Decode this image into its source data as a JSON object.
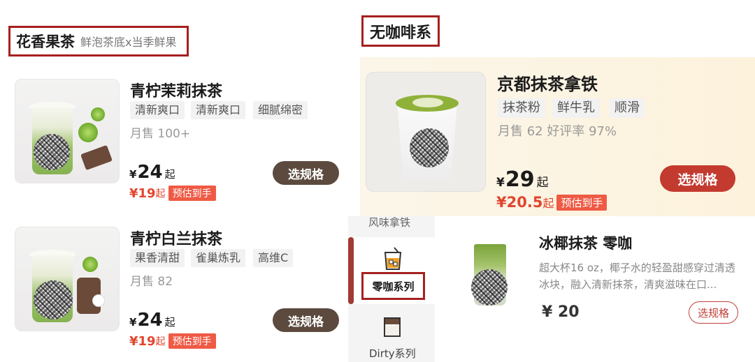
{
  "left_section": {
    "title": "花香果茶",
    "subtitle": "鲜泡茶底x当季鲜果"
  },
  "products": [
    {
      "name": "青柠茉莉抹茶",
      "tags": [
        "清新爽口",
        "清新爽口",
        "细腻绵密"
      ],
      "sales": "月售 100+",
      "price_symbol": "¥",
      "price": "24",
      "price_suffix": "起",
      "est_price": "¥19",
      "est_suffix": "起",
      "est_badge": "预估到手",
      "button": "选规格"
    },
    {
      "name": "青柠白兰抹茶",
      "tags": [
        "果香清甜",
        "雀巢炼乳",
        "高维C"
      ],
      "sales": "月售 82",
      "price_symbol": "¥",
      "price": "24",
      "price_suffix": "起",
      "est_price": "¥19",
      "est_suffix": "起",
      "est_badge": "预估到手",
      "button": "选规格"
    }
  ],
  "right_section": {
    "title": "无咖啡系"
  },
  "featured": {
    "name": "京都抹茶拿铁",
    "tags": [
      "抹茶粉",
      "鲜牛乳",
      "顺滑"
    ],
    "stats": "月售 62 好评率 97%",
    "price_symbol": "¥",
    "price": "29",
    "price_suffix": "起",
    "est_price": "¥20.5",
    "est_suffix": "起",
    "est_badge": "预估到手",
    "button": "选规格"
  },
  "sidebar": {
    "items": [
      {
        "label": "风味拿铁",
        "icon": "latte-cup-icon"
      },
      {
        "label": "零咖系列",
        "icon": "iced-drink-icon",
        "active": true
      },
      {
        "label": "Dirty系列",
        "icon": "dirty-cup-icon"
      }
    ]
  },
  "coconut": {
    "name": "冰椰抹茶 零咖",
    "description": "超大杯16 oz，椰子水的轻盈甜感穿过清透冰块，融入清新抹茶，清爽滋味在口...",
    "price": "¥ 20",
    "button": "选规格"
  },
  "colors": {
    "brown_button": "#5c4a3f",
    "red_button": "#c33a2f",
    "accent_red": "#e2452f",
    "highlight_border": "#a5201f"
  }
}
